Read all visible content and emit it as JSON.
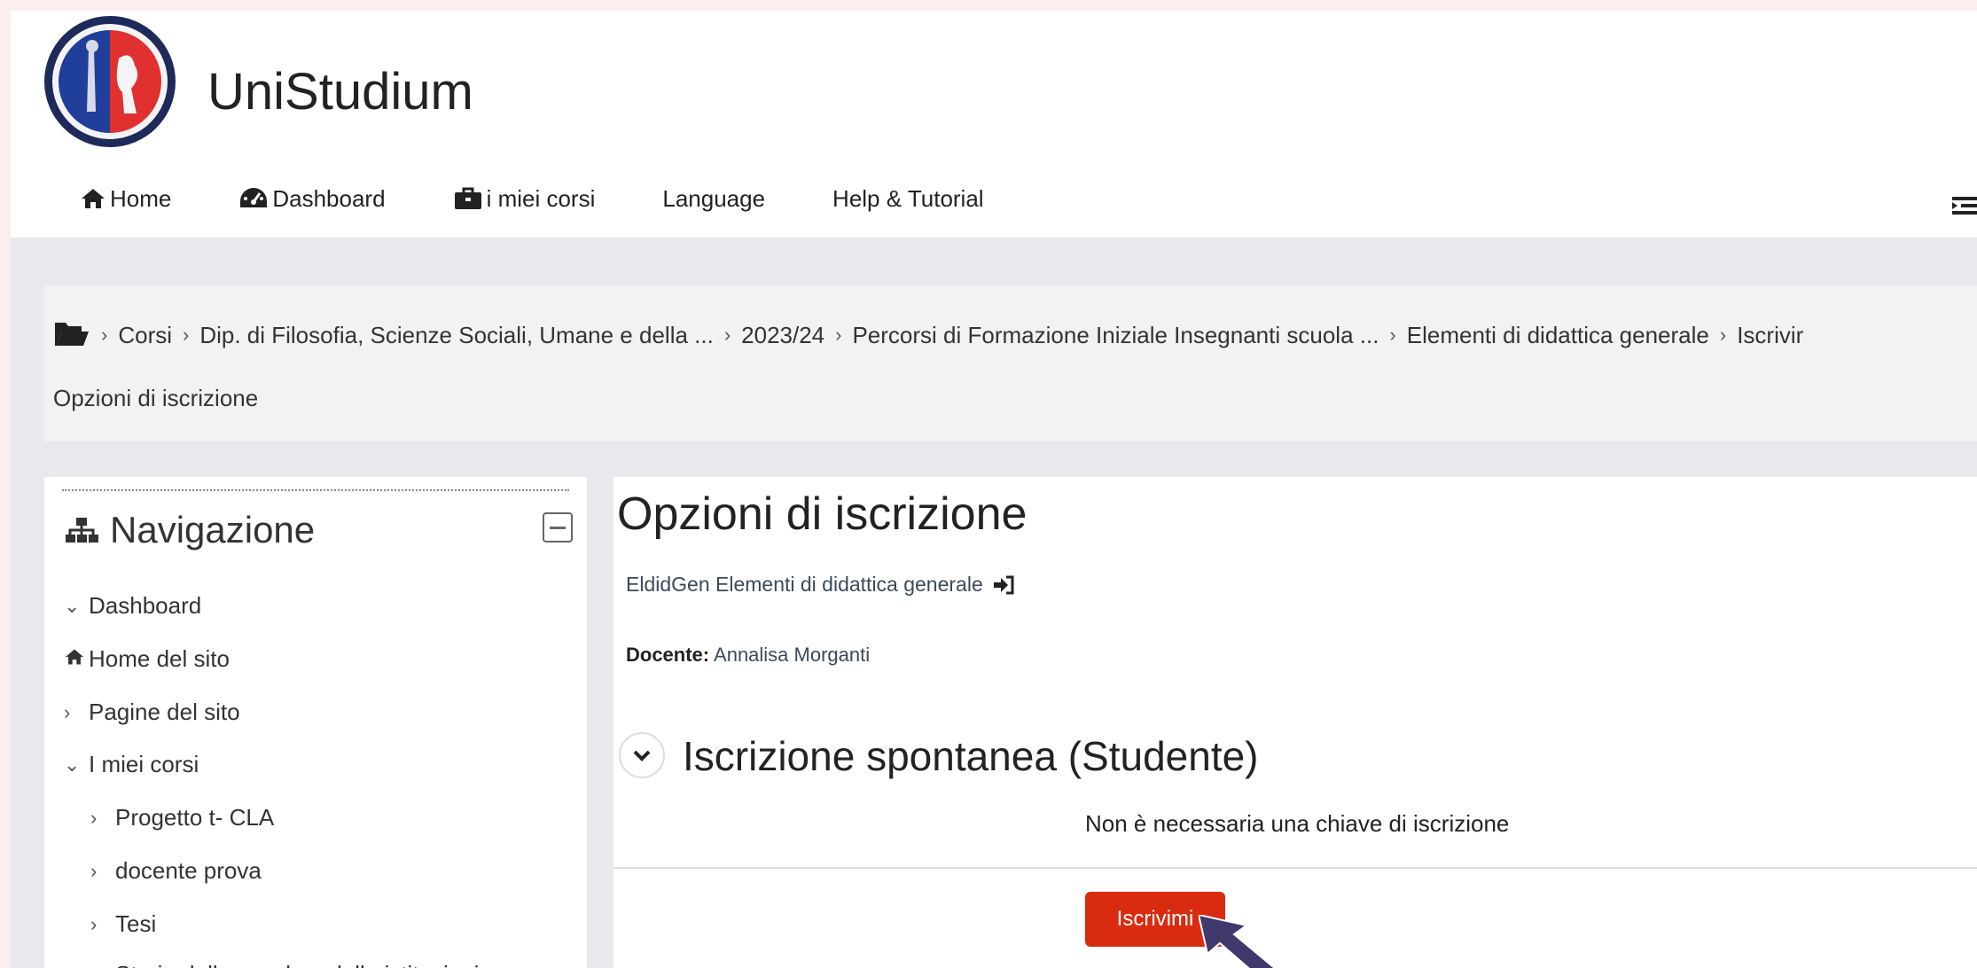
{
  "site": {
    "title": "UniStudium"
  },
  "nav": [
    {
      "label": "Home",
      "icon": "home-icon"
    },
    {
      "label": "Dashboard",
      "icon": "dashboard-icon"
    },
    {
      "label": "i miei corsi",
      "icon": "briefcase-icon"
    },
    {
      "label": "Language"
    },
    {
      "label": "Help & Tutorial"
    }
  ],
  "breadcrumb": {
    "items": [
      "Corsi",
      "Dip. di Filosofia, Scienze Sociali, Umane e della ...",
      "2023/24",
      "Percorsi di Formazione Iniziale Insegnanti scuola ...",
      "Elementi di didattica generale",
      "Iscrivir"
    ],
    "current": "Opzioni di iscrizione"
  },
  "navigation_block": {
    "title": "Navigazione",
    "items": [
      {
        "label": "Dashboard",
        "glyph": "⌄"
      },
      {
        "label": "Home del sito",
        "glyph": "home-icon"
      },
      {
        "label": "Pagine del sito",
        "glyph": "›"
      },
      {
        "label": "I miei corsi",
        "glyph": "⌄"
      },
      {
        "label": "Progetto t- CLA",
        "glyph": "›"
      },
      {
        "label": "docente prova",
        "glyph": "›"
      },
      {
        "label": "Tesi",
        "glyph": "›"
      },
      {
        "label": "Storia della scuola e delle istituzioni",
        "glyph": "›"
      }
    ]
  },
  "main": {
    "title": "Opzioni di iscrizione",
    "course_link": "EldidGen Elementi di didattica generale",
    "teacher_label": "Docente:",
    "teacher_name": "Annalisa Morganti",
    "section_title": "Iscrizione spontanea (Studente)",
    "no_key_text": "Non è necessaria una chiave di iscrizione",
    "enroll_button": "Iscrivimi"
  },
  "colors": {
    "accent": "#d92b0f",
    "page_bg": "#e8e8ee",
    "arrow": "#3f3a6b"
  }
}
